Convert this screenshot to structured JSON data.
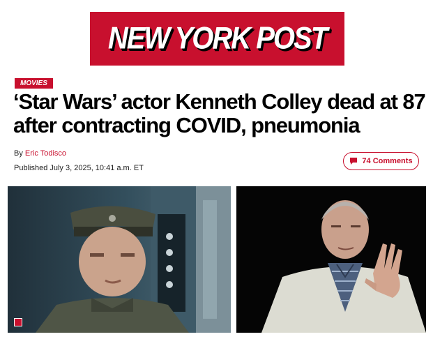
{
  "masthead": {
    "logo_text": "NEW YORK POST"
  },
  "article": {
    "section": "MOVIES",
    "headline": "‘Star Wars’ actor Kenneth Colley dead at 87 after contracting COVID, pneumonia",
    "byline_prefix": "By",
    "author": "Eric Todisco",
    "published": "Published July 3, 2025, 10:41 a.m. ET",
    "comments_label": "74 Comments"
  },
  "colors": {
    "brand": "#c8102e",
    "text": "#000000"
  },
  "icons": {
    "comments": "speech-bubble-icon",
    "gallery": "gallery-icon"
  }
}
